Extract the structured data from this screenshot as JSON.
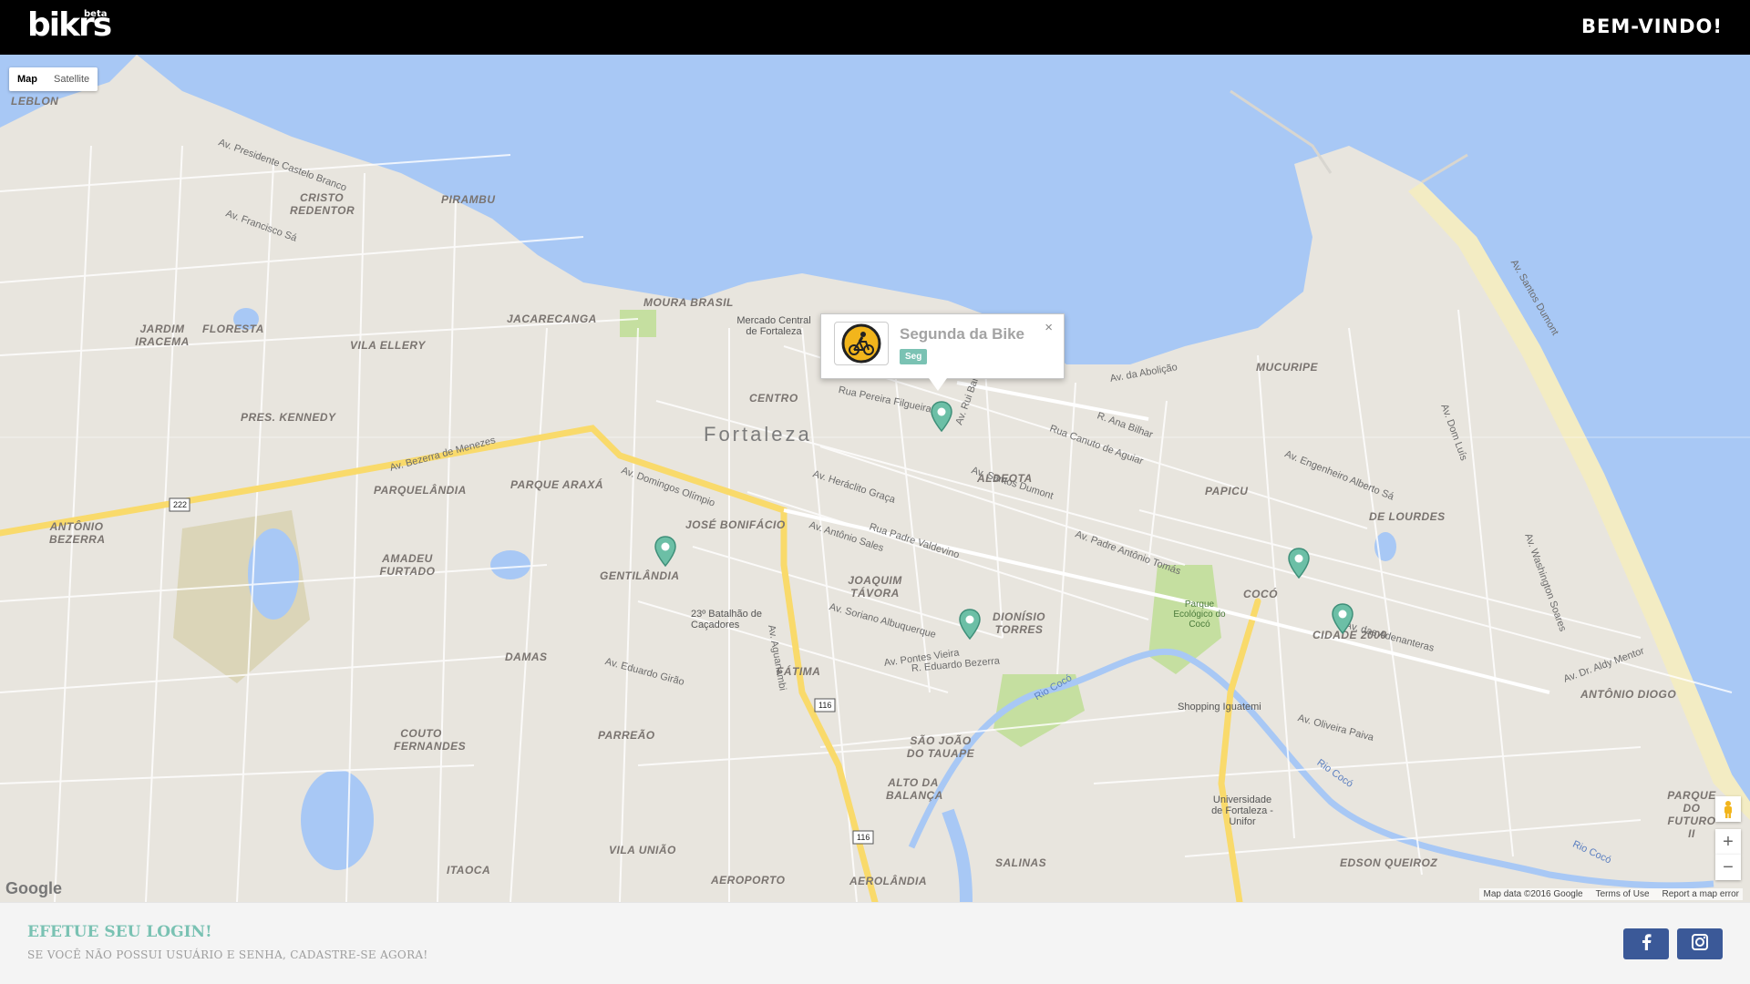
{
  "header": {
    "logo": "bikrs",
    "logo_badge": "beta",
    "welcome": "BEM-VINDO!"
  },
  "map": {
    "type_buttons": [
      "Map",
      "Satellite"
    ],
    "active_type": "Map",
    "city": "Fortaleza",
    "districts": [
      "MOURA BRASIL",
      "JACARECANGA",
      "CENTRO",
      "PIRAMBU",
      "CRISTO REDENTOR",
      "FLORESTA",
      "JARDIM IRACEMA",
      "VILA ELLERY",
      "PRES. KENNEDY",
      "PARQUELÂNDIA",
      "PARQUE ARAXÁ",
      "JOSÉ BONIFÁCIO",
      "ALDEOTA",
      "PAPICU",
      "MUCURIPE",
      "DE LOURDES",
      "ANTÔNIO BEZERRA",
      "AMADEU FURTADO",
      "GENTILÂNDIA",
      "JOAQUIM TÁVORA",
      "DIONÍSIO TORRES",
      "COCÓ",
      "CIDADE 2000",
      "DAMAS",
      "FÁTIMA",
      "PARREÃO",
      "COUTO FERNANDES",
      "SÃO JOÃO DO TAUAPE",
      "ALTO DA BALANÇA",
      "VILA UNIÃO",
      "AEROPORTO",
      "ITAOCA",
      "AEROLÂNDIA",
      "SALINAS",
      "EDSON QUEIROZ",
      "ANTÔNIO DIOGO",
      "PARQUE DO FUTURO II",
      "LEBLON"
    ],
    "streets": [
      "Av. Bezerra de Menezes",
      "Av. Domingos Olímpio",
      "Av. Santos Dumont",
      "Av. Antônio Sales",
      "Av. Heráclito Graça",
      "Rua Padre Valdevino",
      "Av. Pontes Vieira",
      "R. Eduardo Bezerra",
      "Av. Aguanambi",
      "Av. da Abolição",
      "Av. Presidente Castelo Branco",
      "Av. Francisco Sá",
      "Av. Engenheiro Alberto Sá",
      "Av. Padre Antônio Tomás",
      "Rua Pereira Filgueiras",
      "Av. Rui Barbosa",
      "Rua Canuto de Aguiar",
      "R. Ana Bilhar",
      "Av. Soriano Albuquerque",
      "Av. Eduardo Girão",
      "Av. Dom Luís",
      "Av. Washington Soares",
      "Av. Dr. Aldy Mentor",
      "Av. Santos Dumont",
      "Av. das Adenanteras",
      "Av. Oliveira Paiva"
    ],
    "pois": [
      "Mercado Central de Fortaleza",
      "23º Batalhão de Caçadores",
      "Shopping Iguatemi",
      "Universidade de Fortaleza - Unifor",
      "Parque Ecológico do Cocó"
    ],
    "water_labels": [
      "Rio Cocó",
      "Rio Cocó",
      "Rio Cocó"
    ],
    "route_shields": [
      "222",
      "116",
      "116"
    ],
    "infowindow": {
      "title": "Segunda da Bike",
      "badge": "Seg",
      "close": "×"
    },
    "google": "Google",
    "attribution": [
      "Map data ©2016 Google",
      "Terms of Use",
      "Report a map error"
    ],
    "zoom_in": "+",
    "zoom_out": "−",
    "pegman_icon": "pegman-icon",
    "colors": {
      "water": "#a8c8f5",
      "land": "#e8e5de",
      "park": "#c5dfa0",
      "major_road": "#f9da6b",
      "pin": "#6cbfa6"
    }
  },
  "footer": {
    "login_title": "EFETUE SEU LOGIN!",
    "login_subtitle": "SE VOCÊ NÃO POSSUI USUÁRIO E SENHA, CADASTRE-SE AGORA!",
    "social": [
      "facebook-icon",
      "instagram-icon"
    ],
    "colors": {
      "accent": "#7ac2b3",
      "social_bg": "#3b5998"
    }
  }
}
